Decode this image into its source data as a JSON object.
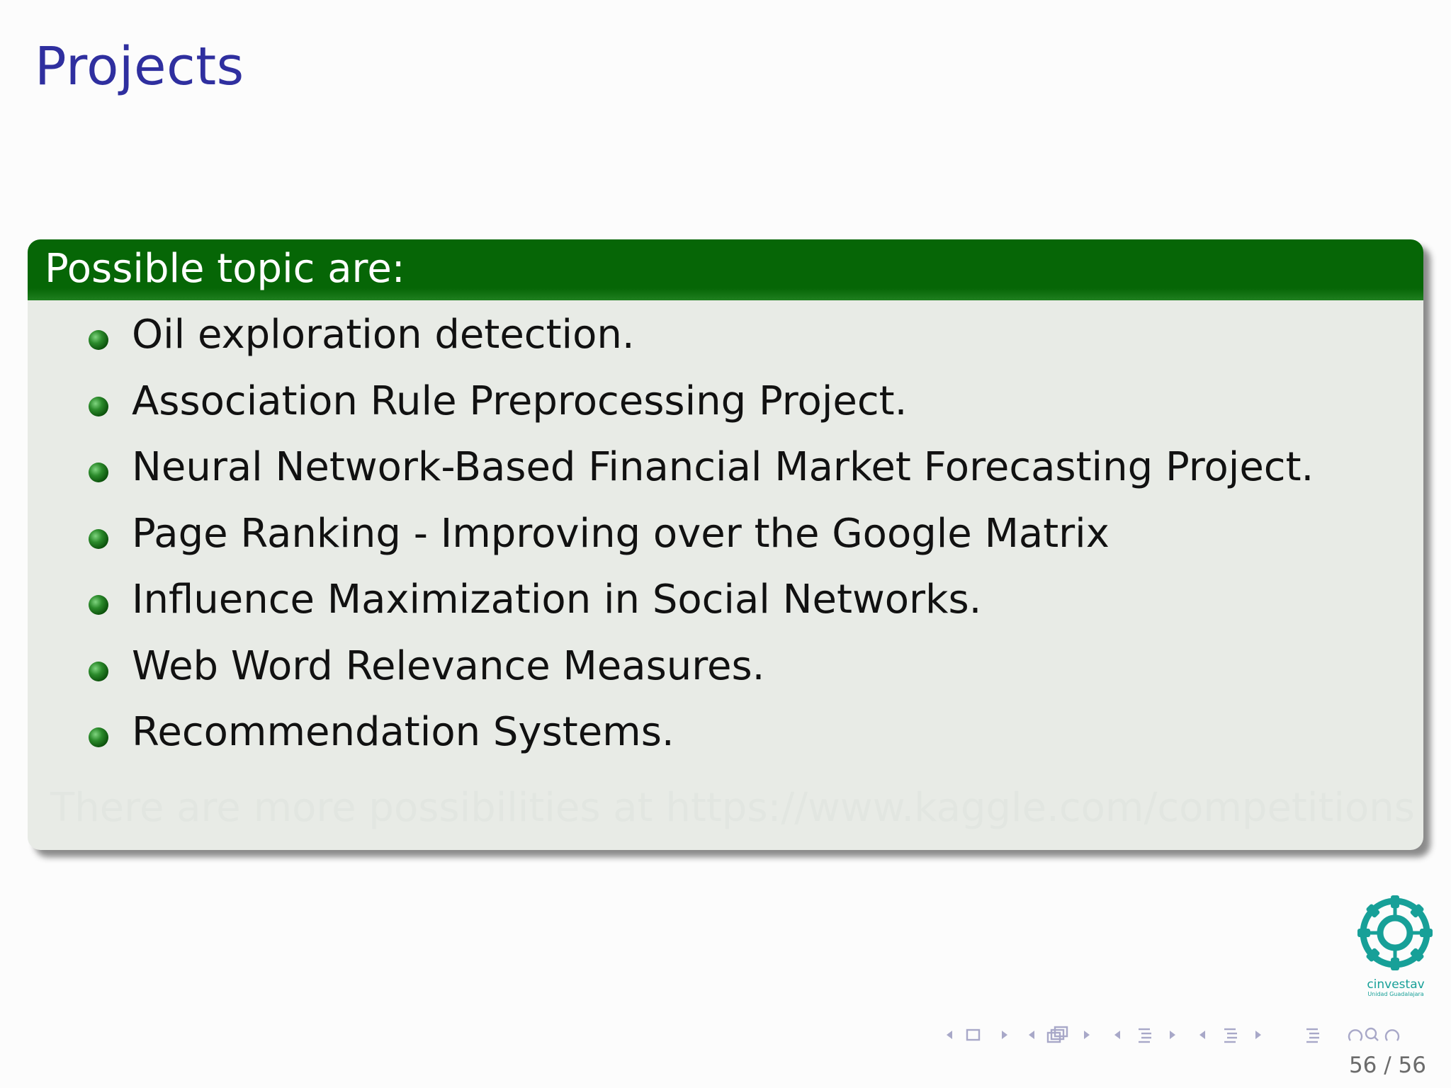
{
  "slide": {
    "title": "Projects"
  },
  "block": {
    "title": "Possible topic are:",
    "items": [
      "Oil exploration detection.",
      "Association Rule Preprocessing Project.",
      "Neural Network-Based Financial Market Forecasting Project.",
      "Page Ranking - Improving over the Google Matrix",
      "Influence Maximization in Social Networks.",
      "Web Word Relevance Measures.",
      "Recommendation Systems."
    ],
    "faded_text": "There are more possibilities at https://www.kaggle.com/competitions"
  },
  "logo": {
    "name": "cinvestav",
    "subtitle": "Unidad Guadalajara"
  },
  "footer": {
    "page_number": "56 / 56"
  },
  "colors": {
    "title": "#2f2f9f",
    "block_header": "#066606",
    "block_body": "#e8ebe6",
    "logo": "#17a098",
    "nav": "#a8a8c8"
  }
}
